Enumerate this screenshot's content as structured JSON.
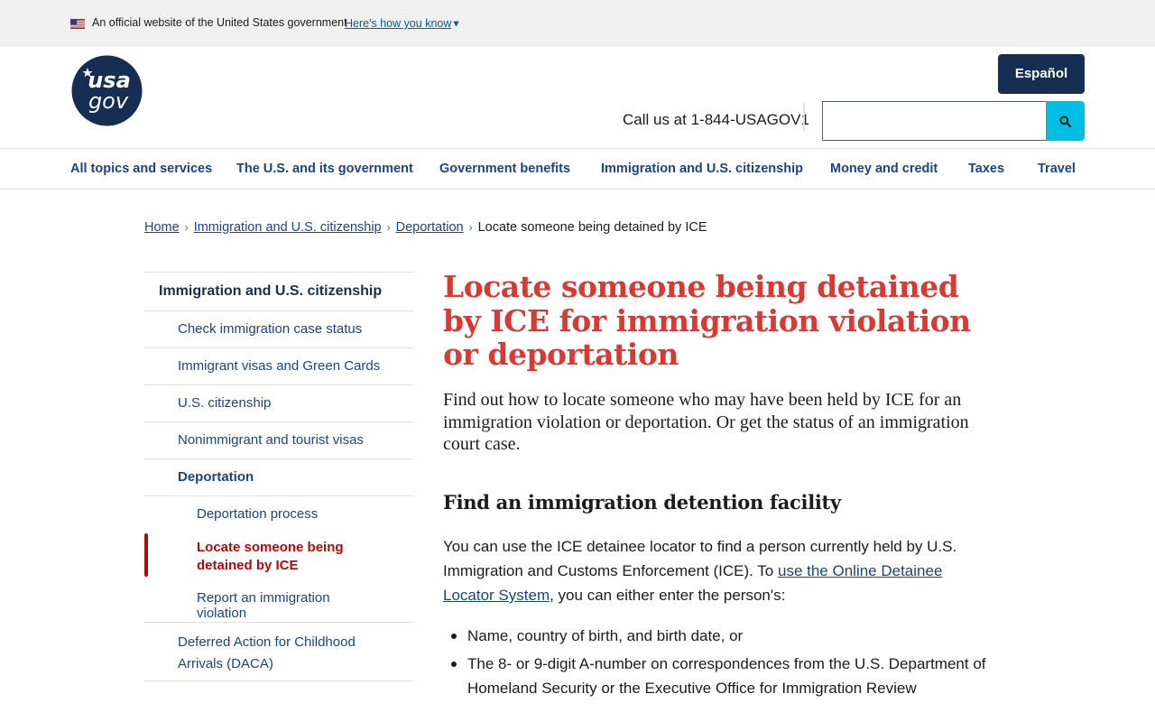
{
  "gov_banner": {
    "text": "An official website of the United States government",
    "link": "Here's how you know",
    "chevron": "▾"
  },
  "header": {
    "logo_text_top": "usa",
    "logo_text_bottom": "gov",
    "espanol_label": "Español",
    "call_text": "Call us at 1-844-USAGOV1",
    "search_value": "",
    "brand_color": "#162e51",
    "search_btn_color": "#00bde3"
  },
  "nav": {
    "items": [
      "All topics and services",
      "The U.S. and its government",
      "Government benefits",
      "Immigration and U.S. citizenship",
      "Money and credit",
      "Taxes",
      "Travel"
    ]
  },
  "breadcrumb": {
    "home": "Home",
    "immigration": "Immigration and U.S. citizenship",
    "deportation": "Deportation",
    "current": "Locate someone being detained by ICE"
  },
  "sidenav": {
    "top": "Immigration and U.S. citizenship",
    "items": [
      "Check immigration case status",
      "Immigrant visas and Green Cards",
      "U.S. citizenship",
      "Nonimmigrant and tourist visas",
      "Deportation"
    ],
    "sub_items": [
      "Deportation process",
      "Locate someone being detained by ICE",
      "Report an immigration violation"
    ],
    "daca": "Deferred Action for Childhood Arrivals (DACA)",
    "active_color": "#b50909"
  },
  "main": {
    "title": "Locate someone being detained by ICE for immigration violation or deportation",
    "intro": "Find out how to locate someone who may have been held by ICE for an immigration violation or deportation. Or get the status of an immigration court case.",
    "h2": "Find an immigration detention facility",
    "para_before": "You can use the ICE detainee locator to find a person currently held by U.S. Immigration and Customs Enforcement (ICE). To ",
    "para_link": "use the Online Detainee Locator System",
    "para_after": ", you can either enter the person's:",
    "list": [
      "Name, country of birth, and birth date, or",
      "The 8- or 9-digit A-number on correspondences from the U.S. Department of Homeland Security or the Executive Office for Immigration Review"
    ],
    "title_color": "#d83933"
  }
}
